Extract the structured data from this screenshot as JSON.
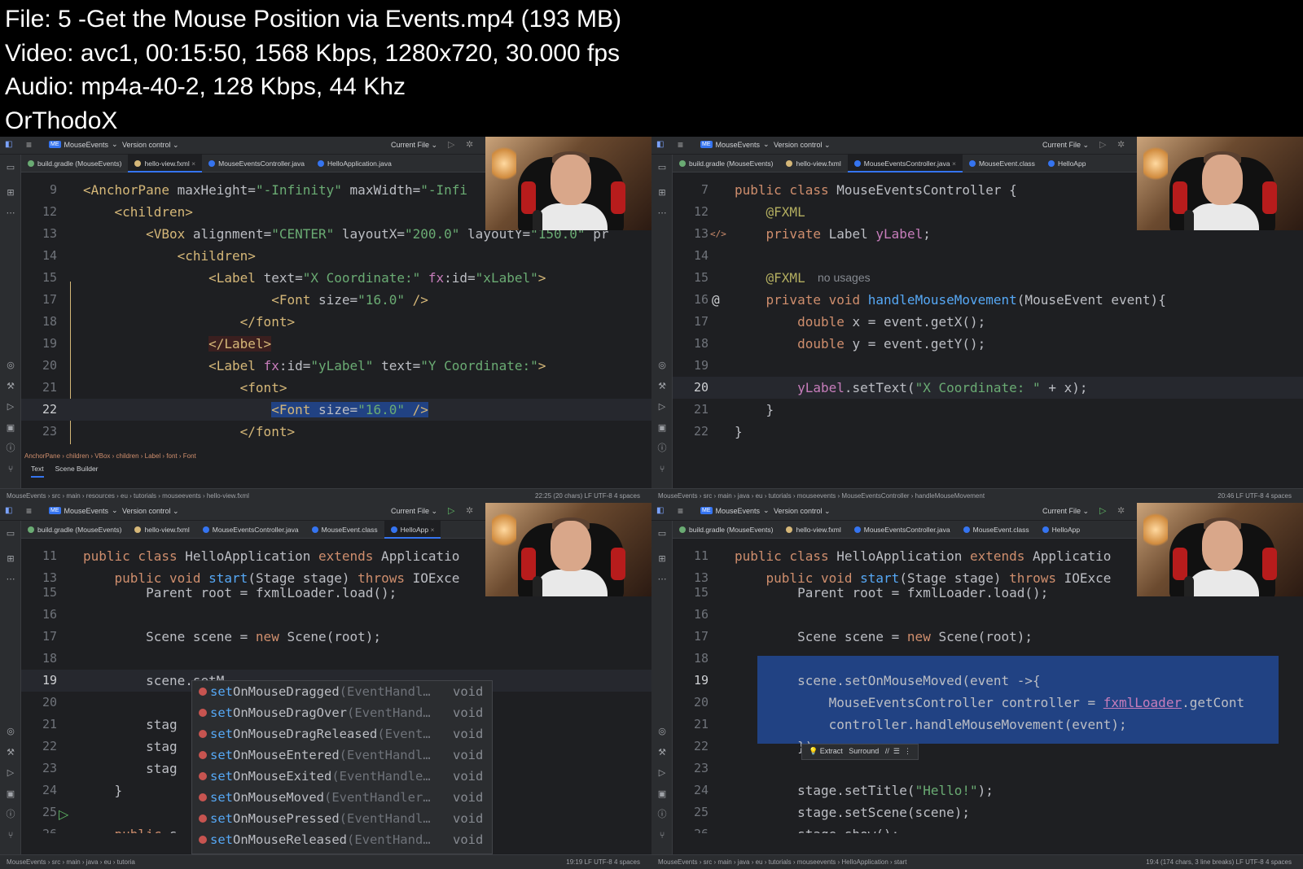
{
  "info": {
    "file": "File: 5 -Get the Mouse Position via Events.mp4 (193 MB)",
    "video": "Video: avc1, 00:15:50, 1568 Kbps, 1280x720, 30.000 fps",
    "audio": "Audio: mp4a-40-2, 128 Kbps, 44 Khz",
    "author": "OrThodoX"
  },
  "colors": {
    "accent": "#3574f0",
    "bg": "#1e1f22",
    "keyword": "#cf8e6d",
    "string": "#6aab73",
    "selection": "#214283"
  },
  "panels": [
    {
      "toolbar": {
        "project_badge": "ME",
        "project": "MouseEvents",
        "version_control": "Version control",
        "run_config": "Current File"
      },
      "tabs": [
        "build.gradle (MouseEvents)",
        "hello-view.fxml",
        "MouseEventsController.java",
        "HelloApplication.java"
      ],
      "breadcrumb": "AnchorPane › children › VBox › children › Label › font › Font",
      "bottom_tabs": [
        "Text",
        "Scene Builder"
      ],
      "status_path": "MouseEvents › src › main › resources › eu › tutorials › mouseevents › hello-view.fxml",
      "status_right": "22:25 (20 chars)   LF   UTF-8   4 spaces"
    },
    {
      "toolbar": {
        "project_badge": "ME",
        "project": "MouseEvents",
        "version_control": "Version control",
        "run_config": "Current File"
      },
      "tabs": [
        "build.gradle (MouseEvents)",
        "hello-view.fxml",
        "MouseEventsController.java",
        "MouseEvent.class",
        "HelloApp"
      ],
      "inline_hint": "no usages",
      "status_path": "MouseEvents › src › main › java › eu › tutorials › mouseevents › MouseEventsController › handleMouseMovement",
      "status_right": "20:46   LF   UTF-8   4 spaces"
    },
    {
      "toolbar": {
        "project_badge": "ME",
        "project": "MouseEvents",
        "version_control": "Version control",
        "run_config": "Current File"
      },
      "tabs": [
        "build.gradle (MouseEvents)",
        "hello-view.fxml",
        "MouseEventsController.java",
        "MouseEvent.class",
        "HelloApp"
      ],
      "completion": [
        {
          "prefix": "set",
          "rest": "OnMouseDragged",
          "params": "(EventHandl…",
          "ret": "void"
        },
        {
          "prefix": "set",
          "rest": "OnMouseDragOver",
          "params": "(EventHand…",
          "ret": "void"
        },
        {
          "prefix": "set",
          "rest": "OnMouseDragReleased",
          "params": "(Event…",
          "ret": "void"
        },
        {
          "prefix": "set",
          "rest": "OnMouseEntered",
          "params": "(EventHandl…",
          "ret": "void"
        },
        {
          "prefix": "set",
          "rest": "OnMouseExited",
          "params": "(EventHandle…",
          "ret": "void"
        },
        {
          "prefix": "set",
          "rest": "OnMouseMoved",
          "params": "(EventHandler…",
          "ret": "void"
        },
        {
          "prefix": "set",
          "rest": "OnMousePressed",
          "params": "(EventHandl…",
          "ret": "void"
        },
        {
          "prefix": "set",
          "rest": "OnMouseReleased",
          "params": "(EventHand…",
          "ret": "void"
        }
      ],
      "status_path": "MouseEvents › src › main › java › eu › tutoria",
      "status_right": "19:19   LF   UTF-8   4 spaces"
    },
    {
      "toolbar": {
        "project_badge": "ME",
        "project": "MouseEvents",
        "version_control": "Version control",
        "run_config": "Current File"
      },
      "tabs": [
        "build.gradle (MouseEvents)",
        "hello-view.fxml",
        "MouseEventsController.java",
        "MouseEvent.class",
        "HelloApp"
      ],
      "intent_bar": {
        "extract": "Extract",
        "surround": "Surround"
      },
      "status_path": "MouseEvents › src › main › java › eu › tutorials › mouseevents › HelloApplication › start",
      "status_right": "19:4 (174 chars, 3 line breaks)   LF   UTF-8   4 spaces"
    }
  ],
  "code": {
    "p1": [
      {
        "n": "9",
        "html": "<span class='t'>&lt;AnchorPane</span> <span class='a'>maxHeight=</span><span class='s'>\"-Infinity\"</span> <span class='a'>maxWidth=</span><span class='s'>\"-Infi</span>"
      },
      {
        "n": "12",
        "html": "    <span class='t'>&lt;children&gt;</span>"
      },
      {
        "n": "13",
        "html": "        <span class='t'>&lt;VBox</span> <span class='a'>alignment=</span><span class='s'>\"CENTER\"</span> <span class='a'>layoutX=</span><span class='s'>\"200.0\"</span> <span class='a'>layoutY=</span><span class='s'>\"150.0\"</span> <span class='a'>pr</span>"
      },
      {
        "n": "14",
        "html": "            <span class='t'>&lt;children&gt;</span>"
      },
      {
        "n": "15",
        "html": "                <span class='t'>&lt;Label</span> <span class='a'>text=</span><span class='s'>\"X Coordinate:\"</span> <span class='m'>fx</span><span class='a'>:id=</span><span class='s'>\"xLabel\"</span><span class='t'>&gt;</span>"
      },
      {
        "n": "17",
        "html": "                        <span class='t'>&lt;Font</span> <span class='a'>size=</span><span class='s'>\"16.0\"</span> <span class='t'>/&gt;</span>"
      },
      {
        "n": "18",
        "html": "                    <span class='t'>&lt;/font&gt;</span>"
      },
      {
        "n": "19",
        "html": "                <span class='t' style='background:#3b1f1f'>&lt;/Label&gt;</span>"
      },
      {
        "n": "20",
        "html": "                <span class='t'>&lt;Label</span> <span class='m'>fx</span><span class='a'>:id=</span><span class='s'>\"yLabel\"</span> <span class='a'>text=</span><span class='s'>\"Y Coordinate:\"</span><span class='t'>&gt;</span>"
      },
      {
        "n": "21",
        "html": "                    <span class='t'>&lt;font&gt;</span>"
      },
      {
        "n": "22",
        "html": "                        <span class='hl'><span class='t'>&lt;Font</span> <span class='a'>size=</span><span class='s'>\"16.0\"</span> <span class='t'>/&gt;</span></span>"
      },
      {
        "n": "23",
        "html": "                    <span class='t'>&lt;/font&gt;</span>"
      }
    ],
    "p2": [
      {
        "n": "7",
        "html": "<span class='k'>public class</span> MouseEventsController {"
      },
      {
        "n": "12",
        "html": "    <span class='an'>@FXML</span>"
      },
      {
        "n": "13",
        "html": "    <span class='k'>private</span> Label <span class='p'>yLabel</span>;"
      },
      {
        "n": "14",
        "html": ""
      },
      {
        "n": "15",
        "html": "    <span class='an'>@FXML</span>"
      },
      {
        "n": "16",
        "html": "    <span class='k'>private void</span> <span class='f'>handleMouseMovement</span>(MouseEvent event){"
      },
      {
        "n": "17",
        "html": "        <span class='k'>double</span> x = event.getX();"
      },
      {
        "n": "18",
        "html": "        <span class='k'>double</span> y = event.getY();"
      },
      {
        "n": "19",
        "html": ""
      },
      {
        "n": "20",
        "html": "        <span class='p'>yLabel</span>.setText(<span class='s'>\"X Coordinate: \"</span> + x);"
      },
      {
        "n": "21",
        "html": "    }"
      },
      {
        "n": "22",
        "html": "}"
      }
    ],
    "p3": [
      {
        "n": "11",
        "html": "<span class='k'>public class</span> HelloApplication <span class='k'>extends</span> Applicatio"
      },
      {
        "n": "13",
        "html": "    <span class='k'>public void</span> <span class='f'>start</span>(Stage stage) <span class='k'>throws</span> IOExce"
      },
      {
        "n": "15",
        "html": "        Parent root = fxmlLoader.load();"
      },
      {
        "n": "16",
        "html": ""
      },
      {
        "n": "17",
        "html": "        Scene scene = <span class='k'>new</span> Scene(root);"
      },
      {
        "n": "18",
        "html": ""
      },
      {
        "n": "19",
        "html": "        scene.setM"
      },
      {
        "n": "20",
        "html": ""
      },
      {
        "n": "21",
        "html": "        stag"
      },
      {
        "n": "22",
        "html": "        stag"
      },
      {
        "n": "23",
        "html": "        stag"
      },
      {
        "n": "24",
        "html": "    }"
      },
      {
        "n": "25",
        "html": ""
      },
      {
        "n": "26",
        "html": "    <span class='k'>public</span> s                         ch(); }"
      }
    ],
    "p4": [
      {
        "n": "11",
        "html": "<span class='k'>public class</span> HelloApplication <span class='k'>extends</span> Applicatio"
      },
      {
        "n": "13",
        "html": "    <span class='k'>public void</span> <span class='f'>start</span>(Stage stage) <span class='k'>throws</span> IOExce"
      },
      {
        "n": "15",
        "html": "        Parent root = fxmlLoader.load();"
      },
      {
        "n": "16",
        "html": ""
      },
      {
        "n": "17",
        "html": "        Scene scene = <span class='k'>new</span> Scene(root);"
      },
      {
        "n": "18",
        "html": ""
      },
      {
        "n": "19",
        "html": "        scene.setOnMouseMoved(event ->{"
      },
      {
        "n": "20",
        "html": "            MouseEventsController controller = <span class='p' style='text-decoration:underline'>fxmlLoader</span>.getCont"
      },
      {
        "n": "21",
        "html": "            controller.handleMouseMovement(event);"
      },
      {
        "n": "22",
        "html": "        });"
      },
      {
        "n": "23",
        "html": ""
      },
      {
        "n": "24",
        "html": "        stage.setTitle(<span class='s'>\"Hello!\"</span>);"
      },
      {
        "n": "25",
        "html": "        stage.setScene(scene);"
      },
      {
        "n": "26",
        "html": "        stage.show();"
      }
    ]
  }
}
